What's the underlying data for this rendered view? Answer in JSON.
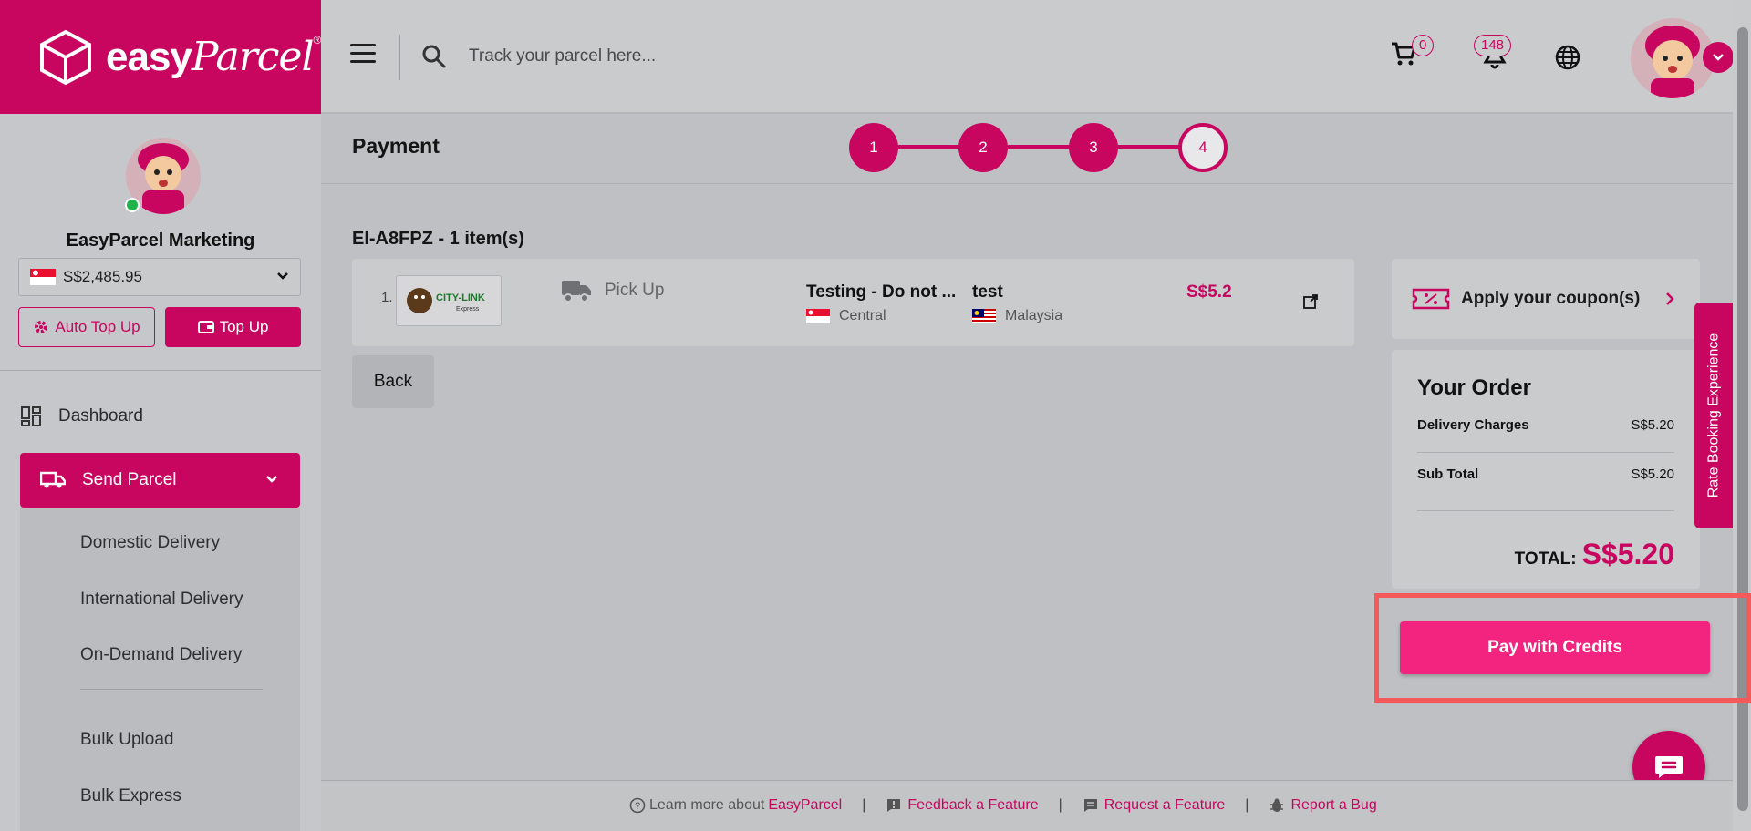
{
  "brand": {
    "logo_main": "easy",
    "logo_script": "Parcel",
    "logo_reg": "®",
    "accent": "#c8055f"
  },
  "topbar": {
    "search_placeholder": "Track your parcel here...",
    "cart_count": "0",
    "notification_count": "148"
  },
  "sidebar": {
    "profile_name": "EasyParcel Marketing",
    "balance": "S$2,485.95",
    "auto_topup_label": "Auto Top Up",
    "topup_label": "Top Up",
    "nav": {
      "dashboard": "Dashboard",
      "send_parcel": "Send Parcel",
      "sub": [
        "Domestic Delivery",
        "International Delivery",
        "On-Demand Delivery",
        "Bulk Upload",
        "Bulk Express"
      ]
    }
  },
  "main": {
    "title": "Payment",
    "steps": [
      "1",
      "2",
      "3",
      "4"
    ],
    "active_step": 4,
    "order_heading": "EI-A8FPZ - 1 item(s)",
    "order_item": {
      "index": "1.",
      "courier_logo_text": "CITY-LINK",
      "courier_logo_sub": "Express",
      "service": "Pick Up",
      "sender_name": "Testing - Do not ...",
      "sender_location": "Central",
      "receiver_name": "test",
      "receiver_location": "Malaysia",
      "price": "S$5.2"
    },
    "back_label": "Back"
  },
  "coupon": {
    "label": "Apply your coupon(s)"
  },
  "order_summary": {
    "title": "Your Order",
    "rows": [
      {
        "label": "Delivery Charges",
        "value": "S$5.20"
      },
      {
        "label": "Sub Total",
        "value": "S$5.20"
      }
    ],
    "total_label": "TOTAL:",
    "total_value": "S$5.20"
  },
  "pay_button": "Pay with Credits",
  "rate_tab": "Rate Booking Experience",
  "footer": {
    "learn_prefix": "Learn more about",
    "learn_link": "EasyParcel",
    "feedback": "Feedback a Feature",
    "request": "Request a Feature",
    "bug": "Report a Bug",
    "separator": "|"
  }
}
